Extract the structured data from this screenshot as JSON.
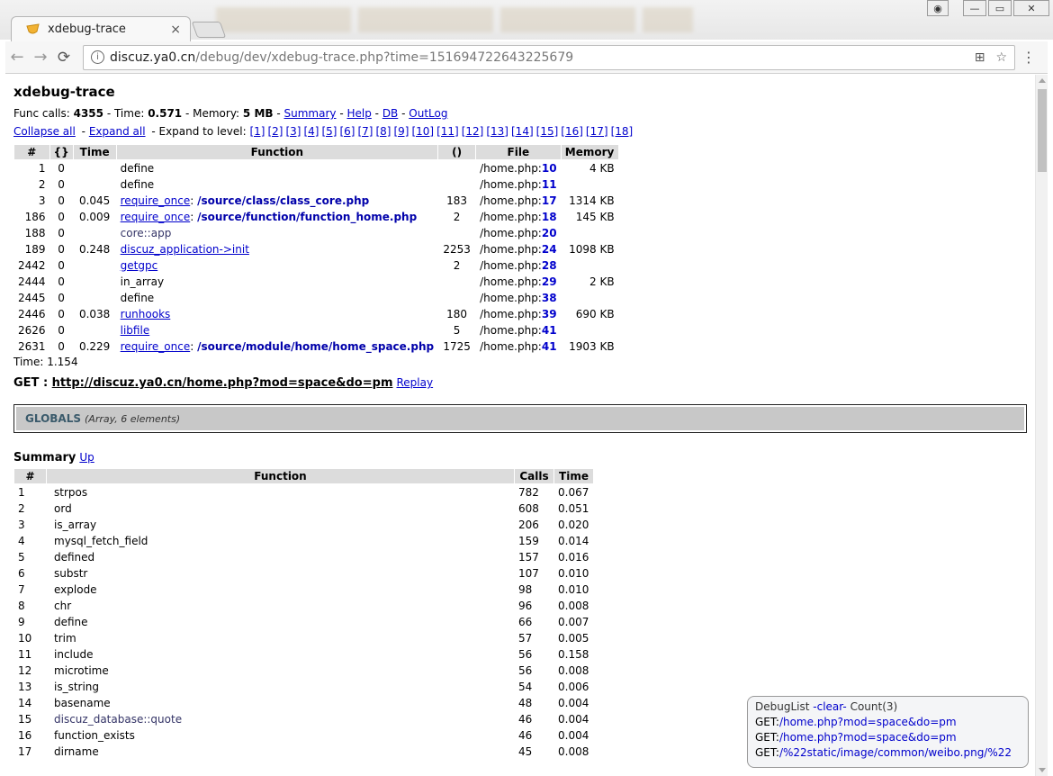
{
  "browser": {
    "tab_title": "xdebug-trace",
    "tab_close": "×",
    "url_host": "discuz.ya0.cn",
    "url_path": "/debug/dev/xdebug-trace.php?time=151694722643225679",
    "back_icon": "←",
    "forward_icon": "→",
    "reload_icon": "⟳",
    "info_icon": "i",
    "translate_icon": "⊞",
    "star_icon": "☆",
    "menu_icon": "⋮",
    "win_profile": "◉",
    "win_min": "—",
    "win_max": "▭",
    "win_close": "✕"
  },
  "page": {
    "title": "xdebug-trace",
    "stats": {
      "func_calls_label": "Func calls: ",
      "func_calls": "4355",
      "time_label": " - Time: ",
      "time": "0.571",
      "memory_label": " - Memory: ",
      "memory": "5 MB",
      "sep1": " - ",
      "summary_link": "Summary",
      "sep2": " - ",
      "help_link": "Help",
      "sep3": " - ",
      "db_link": "DB",
      "sep4": " - ",
      "outlog_link": "OutLog"
    },
    "levels_bar": {
      "collapse_all": "Collapse all",
      "sep1": " - ",
      "expand_all": "Expand all",
      "expand_to_level": " - Expand to level: ",
      "levels": [
        "[1]",
        "[2]",
        "[3]",
        "[4]",
        "[5]",
        "[6]",
        "[7]",
        "[8]",
        "[9]",
        "[10]",
        "[11]",
        "[12]",
        "[13]",
        "[14]",
        "[15]",
        "[16]",
        "[17]",
        "[18]"
      ]
    },
    "trace_table": {
      "headers": [
        "#",
        "{}",
        "Time",
        "Function",
        "()",
        "File",
        "Memory"
      ],
      "rows": [
        {
          "num": "1",
          "braces": "0",
          "time": "",
          "func": "define",
          "func_style": "plain",
          "arg": "",
          "calls": "",
          "file": "/home.php:",
          "line": "10",
          "mem": "4 KB"
        },
        {
          "num": "2",
          "braces": "0",
          "time": "",
          "func": "define",
          "func_style": "plain",
          "arg": "",
          "calls": "",
          "file": "/home.php:",
          "line": "11",
          "mem": ""
        },
        {
          "num": "3",
          "braces": "0",
          "time": "0.045",
          "func": "require_once",
          "func_style": "link",
          "arg": "/source/class/class_core.php",
          "calls": "183",
          "file": "/home.php:",
          "line": "17",
          "mem": "1314 KB"
        },
        {
          "num": "186",
          "braces": "0",
          "time": "0.009",
          "func": "require_once",
          "func_style": "link",
          "arg": "/source/function/function_home.php",
          "calls": "2",
          "file": "/home.php:",
          "line": "18",
          "mem": "145 KB"
        },
        {
          "num": "188",
          "braces": "0",
          "time": "",
          "func": "core::app",
          "func_style": "meta",
          "arg": "",
          "calls": "",
          "file": "/home.php:",
          "line": "20",
          "mem": ""
        },
        {
          "num": "189",
          "braces": "0",
          "time": "0.248",
          "func": "discuz_application->init",
          "func_style": "link",
          "arg": "",
          "calls": "2253",
          "file": "/home.php:",
          "line": "24",
          "mem": "1098 KB"
        },
        {
          "num": "2442",
          "braces": "0",
          "time": "",
          "func": "getgpc",
          "func_style": "link",
          "arg": "",
          "calls": "2",
          "file": "/home.php:",
          "line": "28",
          "mem": ""
        },
        {
          "num": "2444",
          "braces": "0",
          "time": "",
          "func": "in_array",
          "func_style": "plain",
          "arg": "",
          "calls": "",
          "file": "/home.php:",
          "line": "29",
          "mem": "2 KB"
        },
        {
          "num": "2445",
          "braces": "0",
          "time": "",
          "func": "define",
          "func_style": "plain",
          "arg": "",
          "calls": "",
          "file": "/home.php:",
          "line": "38",
          "mem": ""
        },
        {
          "num": "2446",
          "braces": "0",
          "time": "0.038",
          "func": "runhooks",
          "func_style": "link",
          "arg": "",
          "calls": "180",
          "file": "/home.php:",
          "line": "39",
          "mem": "690 KB"
        },
        {
          "num": "2626",
          "braces": "0",
          "time": "",
          "func": "libfile",
          "func_style": "link",
          "arg": "",
          "calls": "5",
          "file": "/home.php:",
          "line": "41",
          "mem": ""
        },
        {
          "num": "2631",
          "braces": "0",
          "time": "0.229",
          "func": "require_once",
          "func_style": "link",
          "arg": "/source/module/home/home_space.php",
          "calls": "1725",
          "file": "/home.php:",
          "line": "41",
          "mem": "1903 KB"
        }
      ]
    },
    "time_after": "Time: 1.154",
    "get_label": "GET : ",
    "get_url": "http://discuz.ya0.cn/home.php?mod=space&do=pm",
    "replay": "Replay",
    "globals_title": "GLOBALS",
    "globals_meta": "(Array, 6 elements)",
    "summary_title": "Summary",
    "summary_up": "Up",
    "summary_table": {
      "headers": [
        "#",
        "Function",
        "Calls",
        "Time"
      ],
      "rows": [
        {
          "num": "1",
          "func": "strpos",
          "style": "plain",
          "calls": "782",
          "time": "0.067"
        },
        {
          "num": "2",
          "func": "ord",
          "style": "plain",
          "calls": "608",
          "time": "0.051"
        },
        {
          "num": "3",
          "func": "is_array",
          "style": "plain",
          "calls": "206",
          "time": "0.020"
        },
        {
          "num": "4",
          "func": "mysql_fetch_field",
          "style": "plain",
          "calls": "159",
          "time": "0.014"
        },
        {
          "num": "5",
          "func": "defined",
          "style": "plain",
          "calls": "157",
          "time": "0.016"
        },
        {
          "num": "6",
          "func": "substr",
          "style": "plain",
          "calls": "107",
          "time": "0.010"
        },
        {
          "num": "7",
          "func": "explode",
          "style": "plain",
          "calls": "98",
          "time": "0.010"
        },
        {
          "num": "8",
          "func": "chr",
          "style": "plain",
          "calls": "96",
          "time": "0.008"
        },
        {
          "num": "9",
          "func": "define",
          "style": "plain",
          "calls": "66",
          "time": "0.007"
        },
        {
          "num": "10",
          "func": "trim",
          "style": "plain",
          "calls": "57",
          "time": "0.005"
        },
        {
          "num": "11",
          "func": "include",
          "style": "plain",
          "calls": "56",
          "time": "0.158"
        },
        {
          "num": "12",
          "func": "microtime",
          "style": "plain",
          "calls": "56",
          "time": "0.008"
        },
        {
          "num": "13",
          "func": "is_string",
          "style": "plain",
          "calls": "54",
          "time": "0.006"
        },
        {
          "num": "14",
          "func": "basename",
          "style": "plain",
          "calls": "48",
          "time": "0.004"
        },
        {
          "num": "15",
          "func": "discuz_database::quote",
          "style": "meta",
          "calls": "46",
          "time": "0.004"
        },
        {
          "num": "16",
          "func": "function_exists",
          "style": "plain",
          "calls": "46",
          "time": "0.004"
        },
        {
          "num": "17",
          "func": "dirname",
          "style": "plain",
          "calls": "45",
          "time": "0.008"
        }
      ]
    }
  },
  "debuglist": {
    "title": "DebugList ",
    "clear": "-clear-",
    "count": " Count(3)",
    "items": [
      {
        "method": "GET:",
        "url": "/home.php?mod=space&do=pm"
      },
      {
        "method": "GET:",
        "url": "/home.php?mod=space&do=pm"
      },
      {
        "method": "GET:",
        "url": "/%22static/image/common/weibo.png/%22"
      }
    ]
  }
}
